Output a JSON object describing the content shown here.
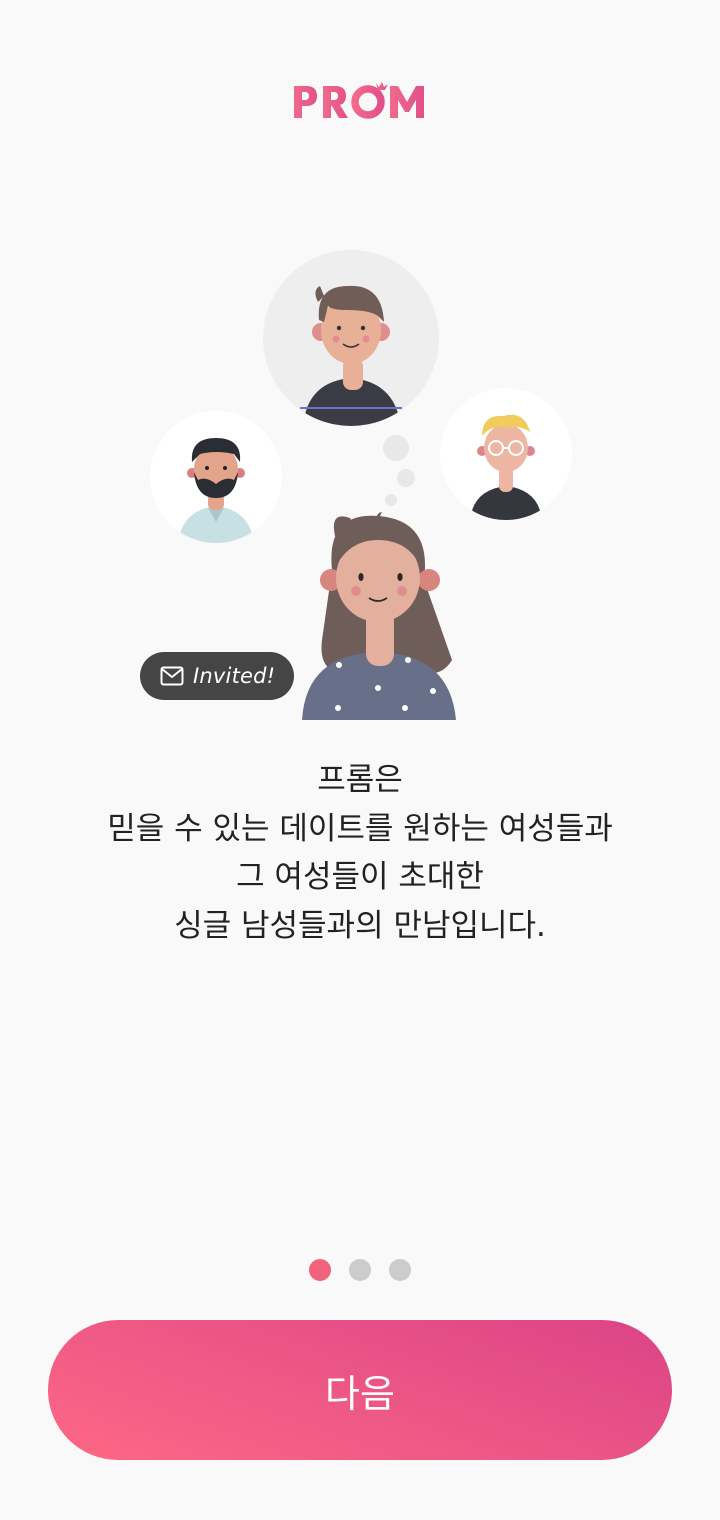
{
  "brand": {
    "logo_text": "PROM",
    "accent_color": "#ec5a88"
  },
  "illustration": {
    "invited_badge": {
      "icon": "envelope-icon",
      "label": "Invited!"
    }
  },
  "description": {
    "lines": [
      "프롬은",
      "믿을 수 있는 데이트를 원하는 여성들과",
      "그 여성들이 초대한",
      "싱글 남성들과의 만남입니다."
    ]
  },
  "pager": {
    "total_pages": 3,
    "current_page": 1,
    "active_color": "#f0637a",
    "inactive_color": "#cccccc"
  },
  "actions": {
    "next_label": "다음"
  }
}
